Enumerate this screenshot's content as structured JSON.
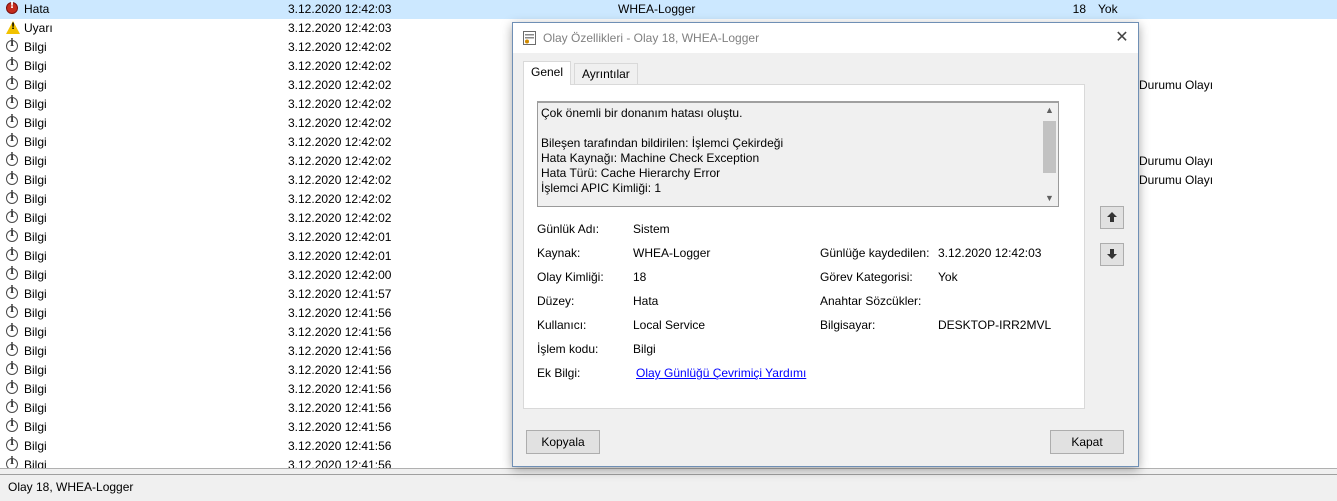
{
  "events": [
    {
      "level": "Hata",
      "type": "error",
      "date": "3.12.2020 12:42:03",
      "source": "WHEA-Logger",
      "id": "18",
      "category": "Yok",
      "extra": "",
      "selected": true
    },
    {
      "level": "Uyarı",
      "type": "warning",
      "date": "3.12.2020 12:42:03",
      "source": "",
      "id": "",
      "category": "",
      "extra": ""
    },
    {
      "level": "Bilgi",
      "type": "info",
      "date": "3.12.2020 12:42:02",
      "source": "",
      "id": "",
      "category": "",
      "extra": ""
    },
    {
      "level": "Bilgi",
      "type": "info",
      "date": "3.12.2020 12:42:02",
      "source": "",
      "id": "",
      "category": "",
      "extra": ""
    },
    {
      "level": "Bilgi",
      "type": "info",
      "date": "3.12.2020 12:42:02",
      "source": "",
      "id": "",
      "category": "",
      "extra": "Durumu Olayı"
    },
    {
      "level": "Bilgi",
      "type": "info",
      "date": "3.12.2020 12:42:02",
      "source": "",
      "id": "",
      "category": "",
      "extra": ""
    },
    {
      "level": "Bilgi",
      "type": "info",
      "date": "3.12.2020 12:42:02",
      "source": "",
      "id": "",
      "category": "",
      "extra": ""
    },
    {
      "level": "Bilgi",
      "type": "info",
      "date": "3.12.2020 12:42:02",
      "source": "",
      "id": "",
      "category": "",
      "extra": ""
    },
    {
      "level": "Bilgi",
      "type": "info",
      "date": "3.12.2020 12:42:02",
      "source": "",
      "id": "",
      "category": "",
      "extra": "Durumu Olayı"
    },
    {
      "level": "Bilgi",
      "type": "info",
      "date": "3.12.2020 12:42:02",
      "source": "",
      "id": "",
      "category": "",
      "extra": "Durumu Olayı"
    },
    {
      "level": "Bilgi",
      "type": "info",
      "date": "3.12.2020 12:42:02",
      "source": "",
      "id": "",
      "category": "",
      "extra": ""
    },
    {
      "level": "Bilgi",
      "type": "info",
      "date": "3.12.2020 12:42:02",
      "source": "",
      "id": "",
      "category": "",
      "extra": ""
    },
    {
      "level": "Bilgi",
      "type": "info",
      "date": "3.12.2020 12:42:01",
      "source": "",
      "id": "",
      "category": "",
      "extra": ""
    },
    {
      "level": "Bilgi",
      "type": "info",
      "date": "3.12.2020 12:42:01",
      "source": "",
      "id": "",
      "category": "",
      "extra": ""
    },
    {
      "level": "Bilgi",
      "type": "info",
      "date": "3.12.2020 12:42:00",
      "source": "",
      "id": "",
      "category": "",
      "extra": ""
    },
    {
      "level": "Bilgi",
      "type": "info",
      "date": "3.12.2020 12:41:57",
      "source": "",
      "id": "",
      "category": "",
      "extra": ""
    },
    {
      "level": "Bilgi",
      "type": "info",
      "date": "3.12.2020 12:41:56",
      "source": "",
      "id": "",
      "category": "",
      "extra": ""
    },
    {
      "level": "Bilgi",
      "type": "info",
      "date": "3.12.2020 12:41:56",
      "source": "",
      "id": "",
      "category": "",
      "extra": ""
    },
    {
      "level": "Bilgi",
      "type": "info",
      "date": "3.12.2020 12:41:56",
      "source": "",
      "id": "",
      "category": "",
      "extra": ""
    },
    {
      "level": "Bilgi",
      "type": "info",
      "date": "3.12.2020 12:41:56",
      "source": "",
      "id": "",
      "category": "",
      "extra": ""
    },
    {
      "level": "Bilgi",
      "type": "info",
      "date": "3.12.2020 12:41:56",
      "source": "",
      "id": "",
      "category": "",
      "extra": ""
    },
    {
      "level": "Bilgi",
      "type": "info",
      "date": "3.12.2020 12:41:56",
      "source": "",
      "id": "",
      "category": "",
      "extra": ""
    },
    {
      "level": "Bilgi",
      "type": "info",
      "date": "3.12.2020 12:41:56",
      "source": "",
      "id": "",
      "category": "",
      "extra": ""
    },
    {
      "level": "Bilgi",
      "type": "info",
      "date": "3.12.2020 12:41:56",
      "source": "",
      "id": "",
      "category": "",
      "extra": ""
    },
    {
      "level": "Bilgi",
      "type": "info",
      "date": "3.12.2020 12:41:56",
      "source": "",
      "id": "",
      "category": "",
      "extra": ""
    }
  ],
  "statusbar": {
    "text": "Olay 18, WHEA-Logger"
  },
  "dialog": {
    "title": "Olay Özellikleri - Olay 18, WHEA-Logger",
    "tabs": [
      "Genel",
      "Ayrıntılar"
    ],
    "active_tab": "Genel",
    "description": "Çok önemli bir donanım hatası oluştu.\n\nBileşen tarafından bildirilen: İşlemci Çekirdeği\nHata Kaynağı: Machine Check Exception\nHata Türü: Cache Hierarchy Error\nİşlemci APIC Kimliği: 1",
    "fields": {
      "log_name_label": "Günlük Adı:",
      "log_name": "Sistem",
      "source_label": "Kaynak:",
      "source": "WHEA-Logger",
      "logged_label": "Günlüğe kaydedilen:",
      "logged": "3.12.2020 12:42:03",
      "event_id_label": "Olay Kimliği:",
      "event_id": "18",
      "task_category_label": "Görev Kategorisi:",
      "task_category": "Yok",
      "level_label": "Düzey:",
      "level": "Hata",
      "keywords_label": "Anahtar Sözcükler:",
      "keywords": "",
      "user_label": "Kullanıcı:",
      "user": "Local Service",
      "computer_label": "Bilgisayar:",
      "computer": "DESKTOP-IRR2MVL",
      "opcode_label": "İşlem kodu:",
      "opcode": "Bilgi",
      "more_info_label": "Ek Bilgi:",
      "more_info_link": "Olay Günlüğü Çevrimiçi Yardımı"
    },
    "copy_button": "Kopyala",
    "close_button": "Kapat"
  },
  "colors": {
    "selection": "#cce8ff",
    "error": "#c42b1c",
    "warning": "#f2c200",
    "link": "#0000ff"
  }
}
